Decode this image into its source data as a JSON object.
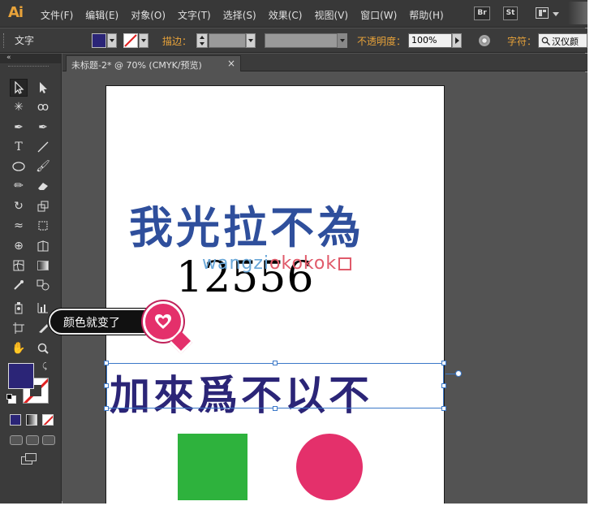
{
  "app": {
    "logo": "Ai"
  },
  "menu": [
    "文件(F)",
    "编辑(E)",
    "对象(O)",
    "文字(T)",
    "选择(S)",
    "效果(C)",
    "视图(V)",
    "窗口(W)",
    "帮助(H)"
  ],
  "menubar_buttons": {
    "bridge": "Br",
    "stock": "St"
  },
  "control_bar": {
    "mode_label": "文字",
    "stroke_label": "描边：",
    "opacity_label": "不透明度：",
    "opacity_value": "100%",
    "char_label": "字符：",
    "font_value": "汉仪颜",
    "fill_color": "#2b2577",
    "stroke_color": "none"
  },
  "document": {
    "tab_title": "未标题-2* @ 70% (CMYK/预览)"
  },
  "artwork": {
    "text_blue": "我光拉不為",
    "text_number": "12556",
    "watermark_1": "wangzi",
    "watermark_2": "okokok",
    "text_purple": "加來爲不以不",
    "shapes": {
      "rect_color": "#2eb23d",
      "circle_color": "#e4306b"
    },
    "text_blue_color": "#2f4f9c",
    "text_purple_color": "#2b2577"
  },
  "callout": {
    "text": "颜色就变了"
  },
  "toolbox": {
    "fill_color": "#2b2577",
    "stroke": "none"
  }
}
